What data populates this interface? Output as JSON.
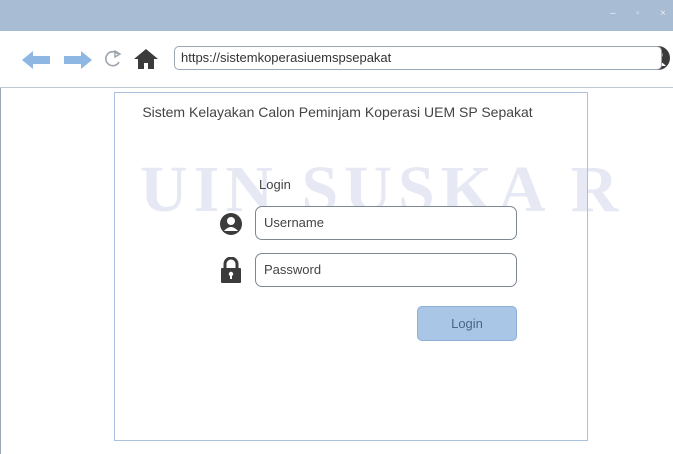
{
  "window": {
    "controls": {
      "minimize": "–",
      "maximize": "▫",
      "close": "×"
    }
  },
  "toolbar": {
    "back_icon": "back-arrow-icon",
    "forward_icon": "forward-arrow-icon",
    "reload_icon": "reload-icon",
    "home_icon": "home-icon",
    "profile_icon": "user-profile-icon",
    "url": "https://sistemkoperasiuemspsepakat"
  },
  "watermark": {
    "text": "UIN SUSKA R"
  },
  "login_panel": {
    "title": "Sistem Kelayakan Calon Peminjam Koperasi UEM SP Sepakat",
    "heading": "Login",
    "username_placeholder": "Username",
    "password_placeholder": "Password",
    "login_button": "Login"
  },
  "colors": {
    "titlebar": "#a8bcd4",
    "accent": "#a9c6e6",
    "nav_arrow": "#8fb7e4"
  }
}
